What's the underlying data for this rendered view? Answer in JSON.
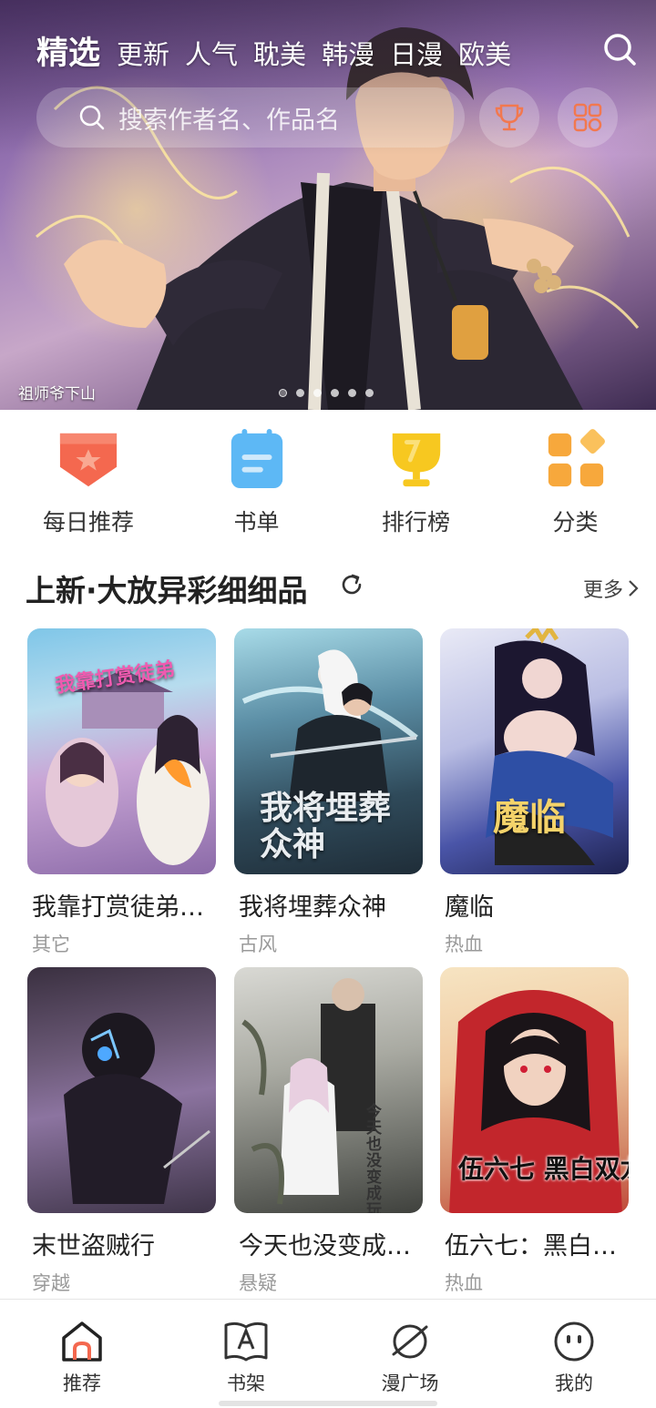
{
  "top_tabs": [
    {
      "label": "精选",
      "active": true
    },
    {
      "label": "更新"
    },
    {
      "label": "人气"
    },
    {
      "label": "耽美"
    },
    {
      "label": "韩漫"
    },
    {
      "label": "日漫"
    },
    {
      "label": "欧美"
    }
  ],
  "search": {
    "placeholder": "搜索作者名、作品名"
  },
  "banner": {
    "caption": "祖师爷下山",
    "slide_count": 6,
    "active_slide": 1
  },
  "quick_entries": [
    {
      "label": "每日推荐",
      "icon": "daily-badge-icon",
      "color": "#f4684f"
    },
    {
      "label": "书单",
      "icon": "notebook-icon",
      "color": "#5db8f5"
    },
    {
      "label": "排行榜",
      "icon": "trophy-icon",
      "color": "#f7c820"
    },
    {
      "label": "分类",
      "icon": "category-grid-icon",
      "color": "#f7a83c"
    }
  ],
  "section": {
    "title": "上新·大放异彩细细品",
    "more_label": "更多"
  },
  "comics": [
    {
      "title": "我靠打赏徒弟…",
      "genre": "其它",
      "cover_text": "我靠打赏徒弟"
    },
    {
      "title": "我将埋葬众神",
      "genre": "古风",
      "cover_text": "我将埋葬众神"
    },
    {
      "title": "魔临",
      "genre": "热血",
      "cover_text": "魔临"
    },
    {
      "title": "末世盗贼行",
      "genre": "穿越",
      "cover_text": ""
    },
    {
      "title": "今天也没变成…",
      "genre": "悬疑",
      "cover_text": "今天也没变成玩偶呢"
    },
    {
      "title": "伍六七：黑白…",
      "genre": "热血",
      "cover_text": "伍六七 黑白双龙"
    }
  ],
  "bottom_nav": [
    {
      "label": "推荐",
      "icon": "home-icon",
      "active": true
    },
    {
      "label": "书架",
      "icon": "bookshelf-icon"
    },
    {
      "label": "漫广场",
      "icon": "planet-icon"
    },
    {
      "label": "我的",
      "icon": "profile-face-icon"
    }
  ],
  "colors": {
    "accent": "#f4684f",
    "text": "#222222",
    "subtext": "#9a9a9a"
  }
}
